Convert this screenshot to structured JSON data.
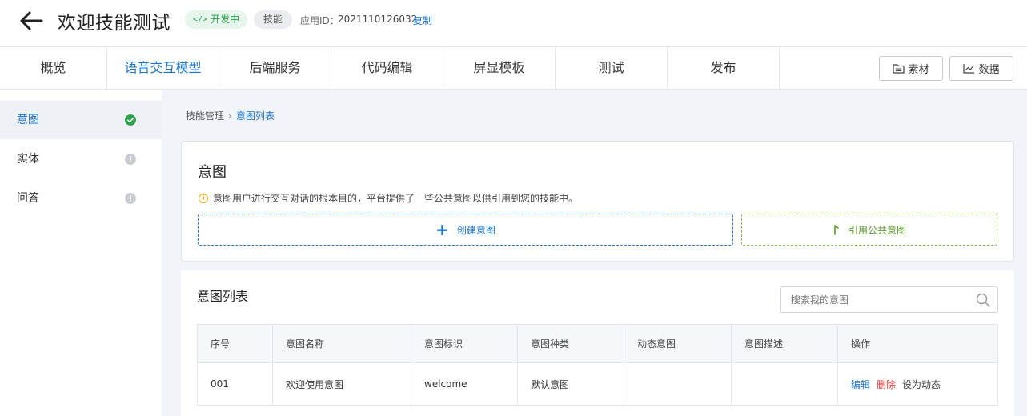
{
  "header": {
    "title": "欢迎技能测试",
    "status_badge": "开发中",
    "type_badge": "技能",
    "app_id_label": "应用ID：",
    "app_id": "2021110126032",
    "copy_label": "复制"
  },
  "tabs": [
    {
      "label": "概览"
    },
    {
      "label": "语音交互模型"
    },
    {
      "label": "后端服务"
    },
    {
      "label": "代码编辑"
    },
    {
      "label": "屏显模板"
    },
    {
      "label": "测试"
    },
    {
      "label": "发布"
    }
  ],
  "active_tab": "语音交互模型",
  "toolbar": {
    "assets_label": "素材",
    "data_label": "数据"
  },
  "sidebar": {
    "items": [
      {
        "label": "意图",
        "status": "done"
      },
      {
        "label": "实体",
        "status": "pending"
      },
      {
        "label": "问答",
        "status": "pending"
      }
    ]
  },
  "breadcrumb": {
    "parent": "技能管理",
    "current": "意图列表"
  },
  "intent_card": {
    "title": "意图",
    "info": "意图用户进行交互对话的根本目的，平台提供了一些公共意图以供引用到您的技能中。",
    "create_label": "创建意图",
    "public_label": "引用公共意图"
  },
  "intent_list": {
    "title": "意图列表",
    "search_placeholder": "搜索我的意图",
    "columns": [
      "序号",
      "意图名称",
      "意图标识",
      "意图种类",
      "动态意图",
      "意图描述",
      "操作"
    ],
    "rows": [
      {
        "no": "001",
        "name": "欢迎使用意图",
        "id": "welcome",
        "kind": "默认意图",
        "dynamic": "",
        "desc": ""
      }
    ],
    "actions": {
      "edit": "编辑",
      "delete": "删除",
      "set_dynamic": "设为动态"
    }
  },
  "colors": {
    "accent": "#1a73c8",
    "success": "#2ca14c",
    "danger": "#e53935",
    "public": "#5a9a2e"
  }
}
